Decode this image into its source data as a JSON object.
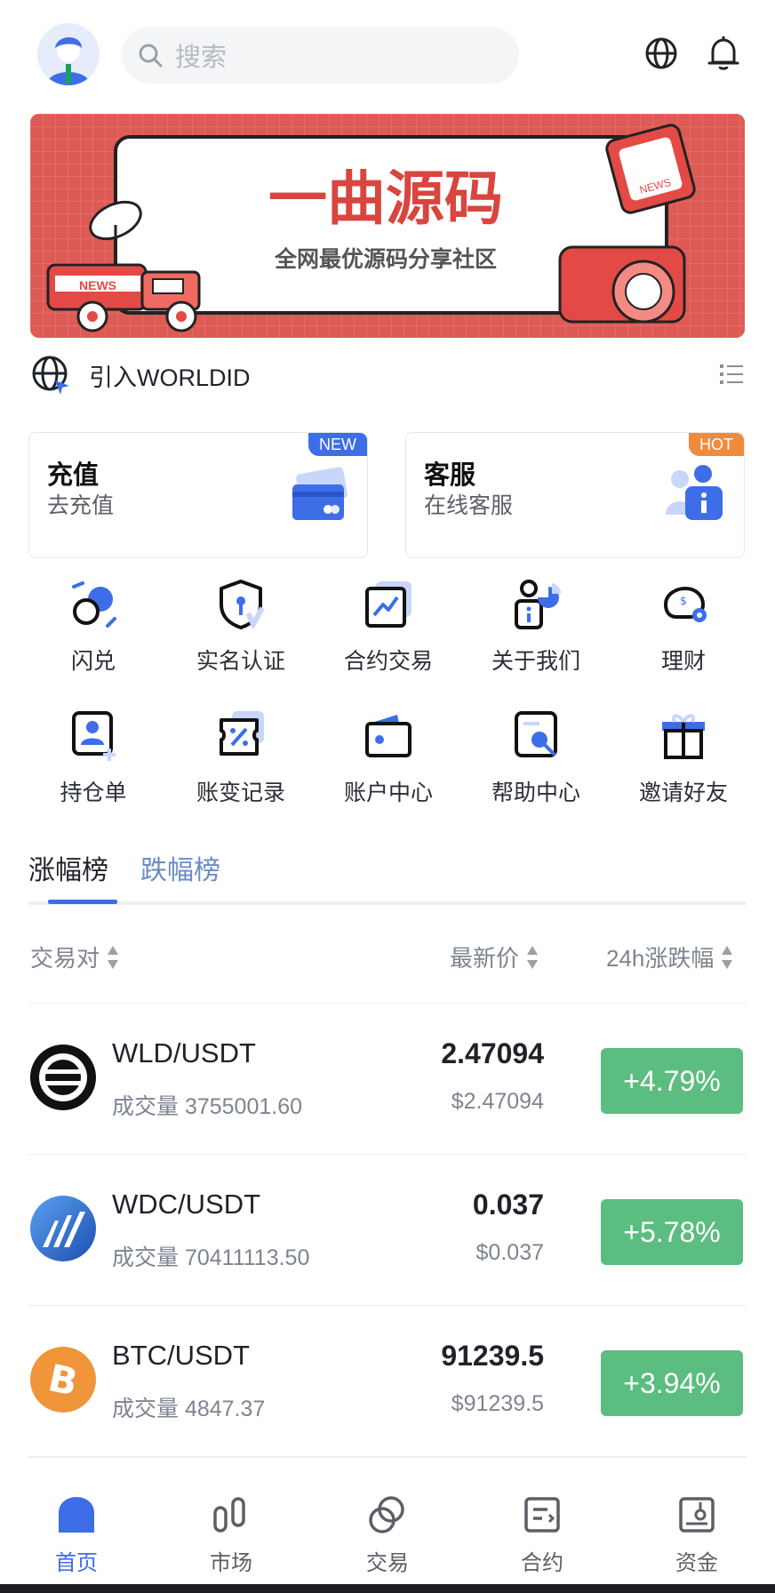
{
  "header": {
    "search_placeholder": "搜索",
    "icons": [
      "avatar",
      "search-icon",
      "globe-icon",
      "bell-icon"
    ]
  },
  "banner": {
    "title": "一曲源码",
    "subtitle": "全网最优源码分享社区",
    "truck_text": "NEWS",
    "badge_text": "NEWS"
  },
  "worldid": {
    "label": "引入WORLDID"
  },
  "cards": [
    {
      "title": "充值",
      "sub": "去充值",
      "badge": "NEW",
      "badge_color": "#3d6ee8",
      "icon": "card-icon"
    },
    {
      "title": "客服",
      "sub": "在线客服",
      "badge": "HOT",
      "badge_color": "#f08a3c",
      "icon": "service-icon"
    }
  ],
  "quick_row1": [
    {
      "label": "闪兑",
      "icon": "swap-icon"
    },
    {
      "label": "实名认证",
      "icon": "shield-icon"
    },
    {
      "label": "合约交易",
      "icon": "chart-icon"
    },
    {
      "label": "关于我们",
      "icon": "about-icon"
    },
    {
      "label": "理财",
      "icon": "piggy-icon"
    }
  ],
  "quick_row2": [
    {
      "label": "持仓单",
      "icon": "position-icon"
    },
    {
      "label": "账变记录",
      "icon": "record-icon"
    },
    {
      "label": "账户中心",
      "icon": "wallet-icon"
    },
    {
      "label": "帮助中心",
      "icon": "help-icon"
    },
    {
      "label": "邀请好友",
      "icon": "gift-icon"
    }
  ],
  "tabs": [
    {
      "label": "涨幅榜",
      "active": true
    },
    {
      "label": "跌幅榜",
      "active": false
    }
  ],
  "table": {
    "headers": [
      "交易对",
      "最新价",
      "24h涨跌幅"
    ],
    "rows": [
      {
        "pair": "WLD/USDT",
        "volume": "成交量 3755001.60",
        "price": "2.47094",
        "usd": "$2.47094",
        "change": "+4.79%",
        "coin": "wld-icon"
      },
      {
        "pair": "WDC/USDT",
        "volume": "成交量 70411113.50",
        "price": "0.037",
        "usd": "$0.037",
        "change": "+5.78%",
        "coin": "wdc-icon"
      },
      {
        "pair": "BTC/USDT",
        "volume": "成交量 4847.37",
        "price": "91239.5",
        "usd": "$91239.5",
        "change": "+3.94%",
        "coin": "btc-icon"
      }
    ]
  },
  "bottom_nav": [
    {
      "label": "首页",
      "active": true,
      "icon": "home-icon"
    },
    {
      "label": "市场",
      "active": false,
      "icon": "market-icon"
    },
    {
      "label": "交易",
      "active": false,
      "icon": "trade-icon"
    },
    {
      "label": "合约",
      "active": false,
      "icon": "contract-icon"
    },
    {
      "label": "资金",
      "active": false,
      "icon": "funds-icon"
    }
  ],
  "colors": {
    "accent": "#3d6ee8",
    "up": "#5bbd7f",
    "banner": "#e05a55",
    "new_badge": "#3d6ee8",
    "hot_badge": "#f08a3c"
  }
}
